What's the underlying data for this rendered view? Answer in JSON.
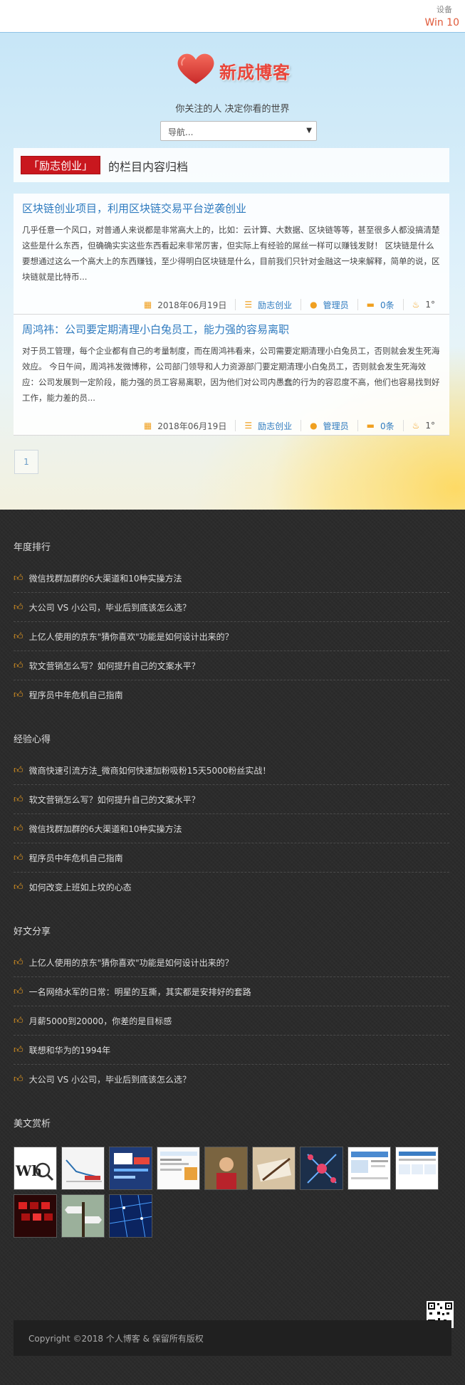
{
  "device": {
    "label": "设备",
    "os": "Win 10"
  },
  "site": {
    "name": "新成博客",
    "slogan": "你关注的人 决定你看的世界"
  },
  "nav_select": {
    "value": "导航..."
  },
  "category": {
    "tag": "「励志创业」",
    "desc": "的栏目内容归档"
  },
  "articles": [
    {
      "title": "区块链创业项目，利用区块链交易平台逆袭创业",
      "excerpt": "几乎任意一个风口，对普通人来说都是非常高大上的，比如：云计算、大数据、区块链等等，甚至很多人都没搞清楚这些是什么东西，但确确实实这些东西看起来非常厉害，但实际上有经验的屌丝一样可以赚钱发财！ 区块链是什么要想通过这么一个高大上的东西赚钱，至少得明白区块链是什么，目前我们只针对金融这一块来解释，简单的说，区块链就是比特币...",
      "date": "2018年06月19日",
      "category": "励志创业",
      "author": "管理员",
      "comments": "0条",
      "likes": "1°"
    },
    {
      "title": "周鸿祎：公司要定期清理小白兔员工，能力强的容易离职",
      "excerpt": "对于员工管理，每个企业都有自己的考量制度，而在周鸿祎看来，公司需要定期清理小白兔员工，否则就会发生死海效应。 今日午间，周鸿祎发微博称，公司部门领导和人力资源部门要定期清理小白兔员工，否则就会发生死海效应：公司发展到一定阶段，能力强的员工容易离职，因为他们对公司内愚蠢的行为的容忍度不高，他们也容易找到好工作，能力差的员...",
      "date": "2018年06月19日",
      "category": "励志创业",
      "author": "管理员",
      "comments": "0条",
      "likes": "1°"
    }
  ],
  "pager": {
    "current": "1"
  },
  "sections": [
    {
      "title": "年度排行",
      "items": [
        "微信找群加群的6大渠道和10种实操方法",
        "大公司 VS 小公司，毕业后到底该怎么选？",
        "上亿人使用的京东\"猜你喜欢\"功能是如何设计出来的？",
        "软文营销怎么写？如何提升自己的文案水平？",
        "程序员中年危机自己指南"
      ]
    },
    {
      "title": "经验心得",
      "items": [
        "微商快速引流方法_微商如何快速加粉吸粉15天5000粉丝实战！",
        "软文营销怎么写？如何提升自己的文案水平？",
        "微信找群加群的6大渠道和10种实操方法",
        "程序员中年危机自己指南",
        "如何改变上班如上坟的心态"
      ]
    },
    {
      "title": "好文分享",
      "items": [
        "上亿人使用的京东\"猜你喜欢\"功能是如何设计出来的？",
        "一名网络水军的日常：明星的互撕，其实都是安排好的套路",
        "月薪5000到20000，你差的是目标感",
        "联想和华为的1994年",
        "大公司 VS 小公司，毕业后到底该怎么选？"
      ]
    }
  ],
  "gallery": {
    "title": "美文赏析"
  },
  "footer": {
    "copyright": "Copyright ©2018 个人博客 & 保留所有版权"
  }
}
